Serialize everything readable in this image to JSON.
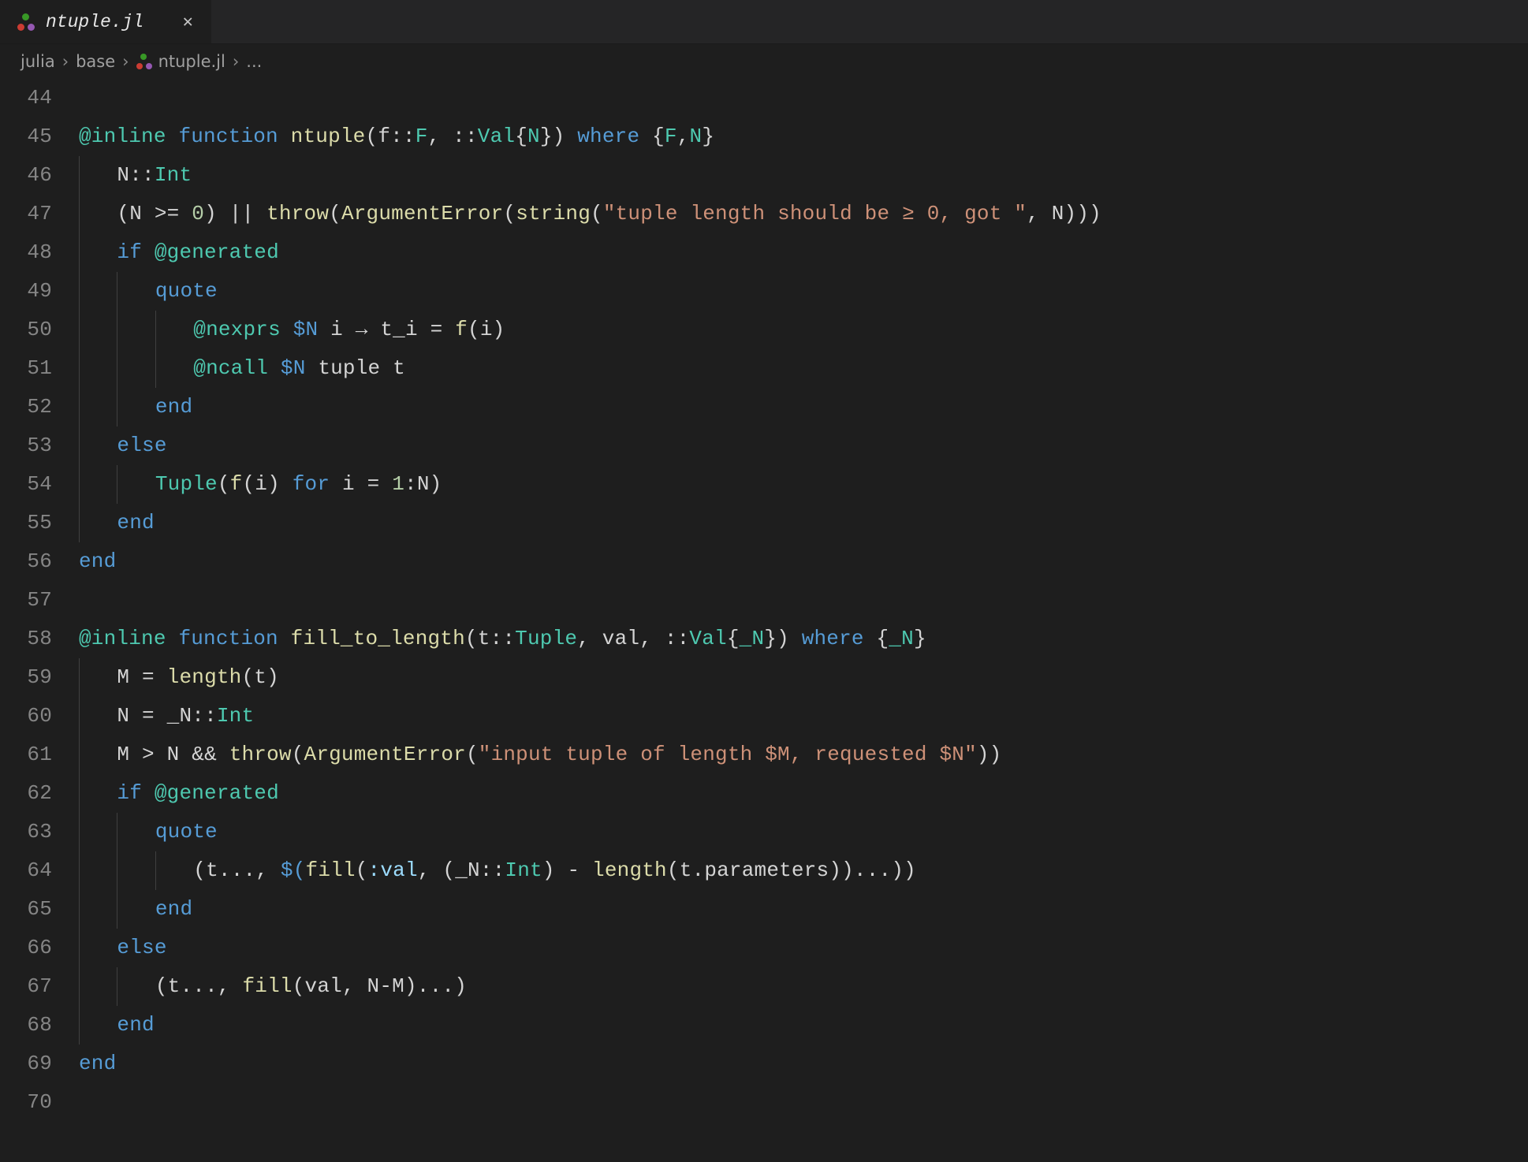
{
  "tab": {
    "filename": "ntuple.jl",
    "close_glyph": "✕"
  },
  "breadcrumb": {
    "seg0": "julia",
    "seg1": "base",
    "seg2": "ntuple.jl",
    "seg3": "...",
    "sep": "›"
  },
  "gutter": {
    "start": 44,
    "end": 70
  },
  "tokens": {
    "at_inline": "@inline",
    "kw_function": "function",
    "fn_ntuple": "ntuple",
    "p_open": "(",
    "id_f": "f",
    "op_decl": "::",
    "ty_F": "F",
    "p_comma_sp": ", ",
    "ty_Val": "Val",
    "p_braceo": "{",
    "id_N": "N",
    "p_bracec": "}",
    "p_close": ")",
    "kw_where": "where",
    "ty_N": "N",
    "sp1": " ",
    "ty_Int": "Int",
    "p_open2": "(",
    "op_gte": " >= ",
    "num_0": "0",
    "p_close2": ")",
    "op_or": " || ",
    "fn_throw": "throw",
    "fn_ArgErr": "ArgumentError",
    "fn_string": "string",
    "str1": "\"tuple length should be ≥ 0, got \"",
    "p_close3": ")))",
    "kw_if": "if",
    "at_generated": "@generated",
    "kw_quote": "quote",
    "at_nexprs": "@nexprs",
    "interp_N": "$N",
    "id_i": "i",
    "op_arrow": " → ",
    "id_t_i": "t_i",
    "op_eq": " = ",
    "id_f2": "f",
    "at_ncall": "@ncall",
    "id_tuple": "tuple",
    "id_t": "t",
    "kw_end": "end",
    "kw_else": "else",
    "ty_Tuple": "Tuple",
    "kw_for": "for",
    "num_1": "1",
    "op_colon": ":",
    "fn_fill2len": "fill_to_length",
    "id_val": "val",
    "id__N": "_N",
    "id_M": "M",
    "fn_length": "length",
    "op_dcolon": "::",
    "op_gt": " > ",
    "op_and": " && ",
    "str2": "\"input tuple of length $M, requested $N\"",
    "p_close2b": "))",
    "p_tdots": "(t..., ",
    "interp_open": "$(",
    "fn_fill": "fill",
    "sym_val": ":val",
    "id_parameters": "parameters",
    "p_dotdotdot": "...",
    "op_minus": "-",
    "txt_NM": "N-M",
    "fn_fill_call": "fill",
    "p_dot": "."
  }
}
